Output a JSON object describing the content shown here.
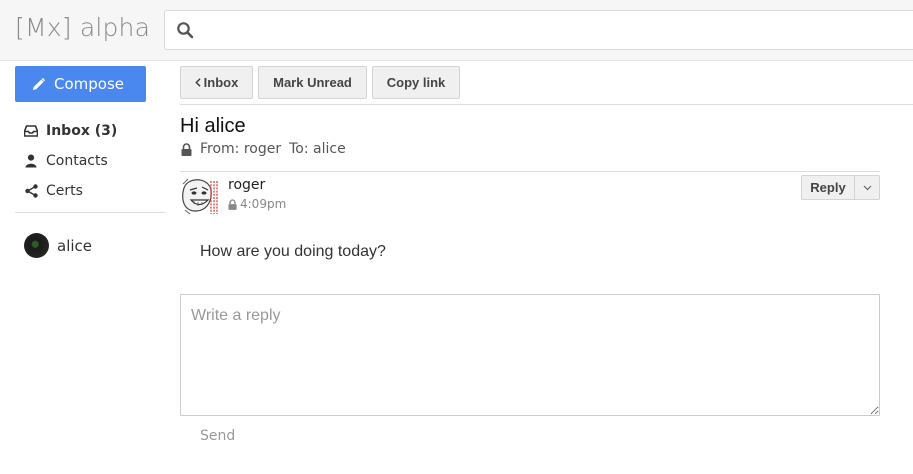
{
  "app": {
    "logo": "[Mx] alpha"
  },
  "search": {
    "placeholder": "",
    "icon": "search-icon"
  },
  "sidebar": {
    "compose_label": "Compose",
    "items": [
      {
        "label": "Inbox (3)",
        "icon": "inbox-icon",
        "active": true
      },
      {
        "label": "Contacts",
        "icon": "person-icon",
        "active": false
      },
      {
        "label": "Certs",
        "icon": "share-icon",
        "active": false
      }
    ],
    "user": {
      "name": "alice"
    }
  },
  "toolbar": {
    "back_label": "Inbox",
    "mark_unread_label": "Mark Unread",
    "copy_link_label": "Copy link"
  },
  "message": {
    "subject": "Hi alice",
    "from_label": "From: roger",
    "to_label": "To: alice",
    "sender": "roger",
    "time": "4:09pm",
    "body": "How are you doing today?",
    "reply_label": "Reply"
  },
  "reply_box": {
    "placeholder": "Write a reply",
    "send_label": "Send"
  },
  "colors": {
    "accent": "#4a87ee",
    "header_bg": "#f6f6f6",
    "button_bg": "#f0f0f0"
  }
}
